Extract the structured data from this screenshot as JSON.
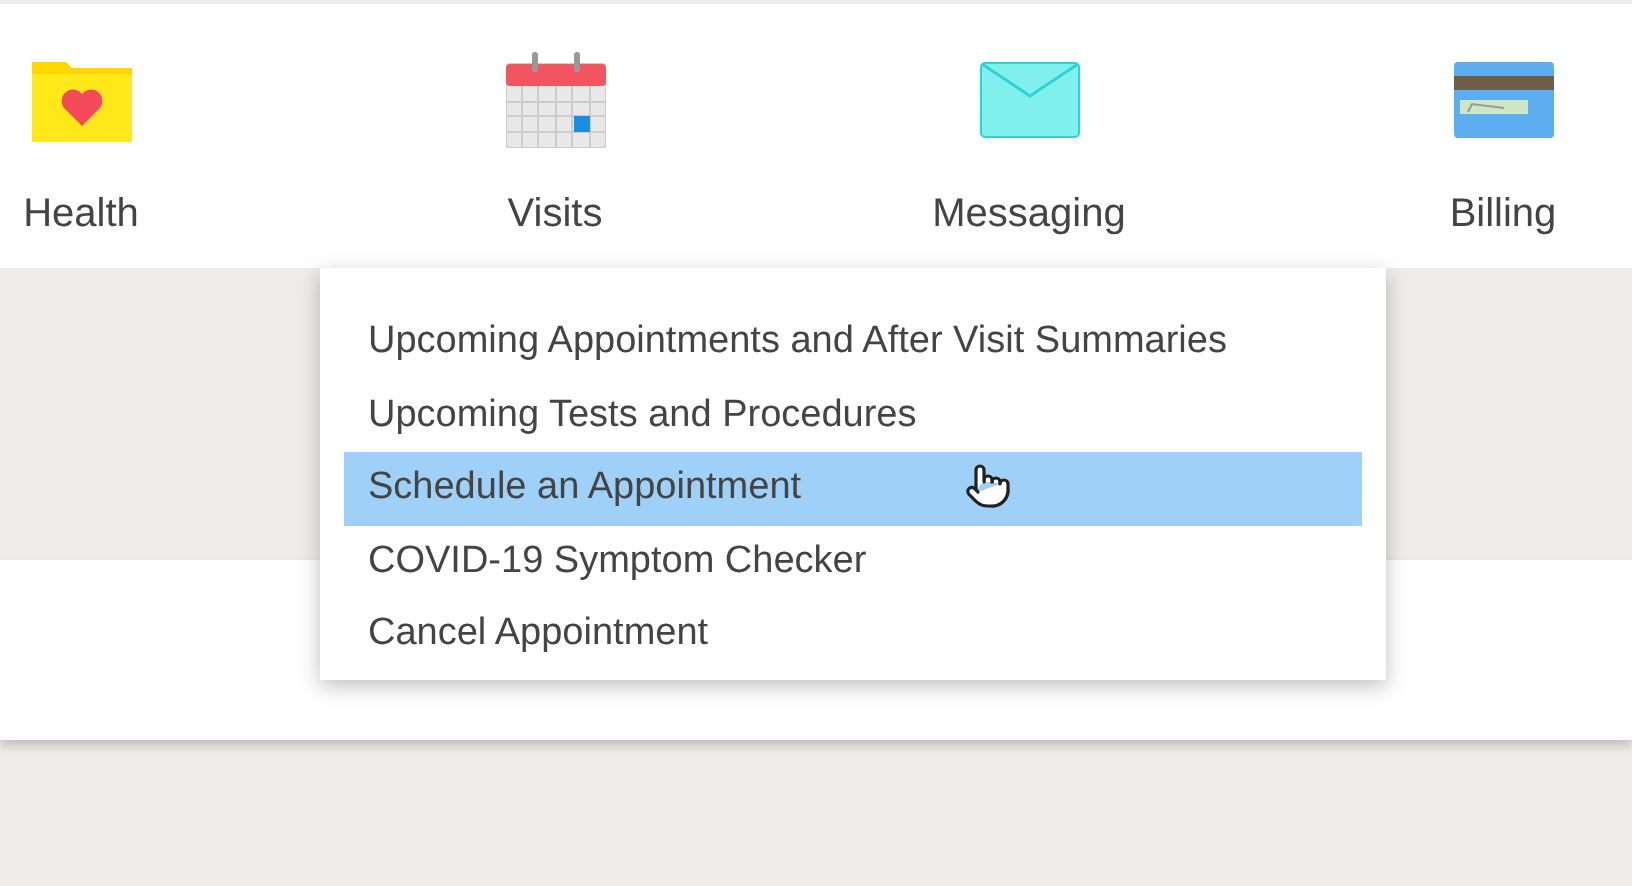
{
  "nav_items": [
    {
      "label": "Health",
      "kind": "health"
    },
    {
      "label": "Visits",
      "kind": "visits"
    },
    {
      "label": "Messaging",
      "kind": "messaging"
    },
    {
      "label": "Billing",
      "kind": "billing"
    }
  ],
  "dropdown": {
    "items": [
      {
        "label": "Upcoming Appointments and After Visit Summaries",
        "selected": false
      },
      {
        "label": "Upcoming Tests and Procedures",
        "selected": false
      },
      {
        "label": "Schedule an Appointment",
        "selected": true
      },
      {
        "label": "COVID-19 Symptom Checker",
        "selected": false
      },
      {
        "label": "Cancel Appointment",
        "selected": false
      }
    ]
  }
}
